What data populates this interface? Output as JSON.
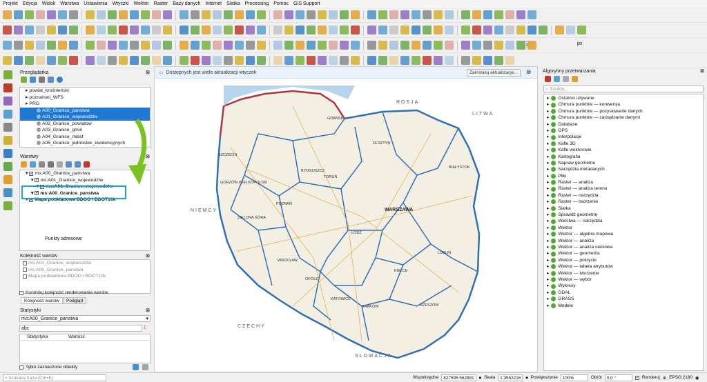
{
  "menu": [
    "Projekt",
    "Edycja",
    "Widok",
    "Warstwa",
    "Ustawienia",
    "Wtyczki",
    "Wektor",
    "Raster",
    "Bazy danych",
    "Internet",
    "Siatka",
    "Processing",
    "Pomoc",
    "GIS Support"
  ],
  "toolbar": {
    "size_value": "12",
    "size_unit": "px"
  },
  "browser": {
    "title": "Przeglądarka",
    "items": [
      {
        "label": "powiat_krośnieński",
        "indent": 1,
        "selected": false
      },
      {
        "label": "poznański_WFS",
        "indent": 1,
        "selected": false
      },
      {
        "label": "PRG",
        "indent": 1,
        "selected": false
      },
      {
        "label": "A00_Granice_panstwa",
        "indent": 3,
        "selected": true
      },
      {
        "label": "A01_Granice_wojewodztw",
        "indent": 3,
        "selected": true
      },
      {
        "label": "A02_Granice_powiatow",
        "indent": 3,
        "selected": false
      },
      {
        "label": "A03_Granice_gmin",
        "indent": 3,
        "selected": false
      },
      {
        "label": "A04_Granice_miast",
        "indent": 3,
        "selected": false
      },
      {
        "label": "A05_Granice_jednostek_ewidencyjnych",
        "indent": 3,
        "selected": false
      }
    ]
  },
  "layers": {
    "title": "Warstwy",
    "items": [
      {
        "label": "ms:A00_Granice_panstwa",
        "indent": 1,
        "bold": false
      },
      {
        "label": "ms:A01_Granice_wojewodztw",
        "indent": 2,
        "bold": false
      },
      {
        "label": "ms:A01_Granice_wojewodztw",
        "indent": 3,
        "bold": true
      },
      {
        "label": "ms:A00_Granice_panstwa",
        "indent": 2,
        "bold": true
      },
      {
        "label": "Mapa podkladowa BDOO i BDOT10k",
        "indent": 1,
        "bold": true
      }
    ],
    "extra": "Punkty adresowe"
  },
  "order": {
    "title": "Kolejność warstw",
    "items": [
      "ms:A01_Granice_wojewodztw",
      "ms:A00_Granice_panstwa",
      "Mapa podkładowa BDOO i BDOT10k"
    ],
    "control_label": "Kontroluj kolejność renderowania warstw",
    "tabs": [
      "Kolejność warstw",
      "Podgląd"
    ]
  },
  "stats": {
    "title": "Statystyki",
    "layer": "ms:A00_Granice_panstwa",
    "field": "abc",
    "col1": "Statystyka",
    "col2": "Wartość",
    "only_selected": "Tylko zaznaczone obiekty"
  },
  "message": {
    "text": "Dostępnych jest wiele aktualizacji wtyczek",
    "button": "Zainstaluj aktualizacje..."
  },
  "map": {
    "neighbors": [
      "ROSJA",
      "LITWA",
      "NIEMCY",
      "CZECHY",
      "SŁOWACJA"
    ],
    "cities": [
      "GDAŃSK",
      "OLSZTYN",
      "SZCZECIN",
      "BYDGOSZCZ",
      "TORUŃ",
      "BIAŁYSTOK",
      "GORZÓW WIELKOPOLSKI",
      "POZNAŃ",
      "WARSZAWA",
      "ZIELONA GÓRA",
      "ŁÓDŹ",
      "WROCŁAW",
      "LUBLIN",
      "OPOLE",
      "KIELCE",
      "KATOWICE",
      "KRAKÓW",
      "RZESZÓW"
    ]
  },
  "processing": {
    "title": "Algorytmy przetwarzania",
    "search": "Szukaj...",
    "items": [
      "Ostatnio używane",
      "Chmura punktów — konwersja",
      "Chmura punktów — pozyskiwanie danych",
      "Chmura punktów — zarządzanie danymi",
      "Database",
      "GPS",
      "Interpolacje",
      "Kafle 3D",
      "Kafle wektorowe",
      "Kartografia",
      "Napraw geometrie",
      "Narzędzia metadanych",
      "Pliki",
      "Raster — analiza",
      "Raster — analiza terenu",
      "Raster — narzędzia",
      "Raster — tworzenie",
      "Siatka",
      "Sprawdź geometrię",
      "Warstwa — narzędzia",
      "Wektor",
      "Wektor — algebra mapowa",
      "Wektor — analiza",
      "Wektor — analiza sieciowa",
      "Wektor — geometria",
      "Wektor — pokrycie",
      "Wektor — tabela atrybutów",
      "Wektor — tworzenie",
      "Wektor — wybór",
      "Wykresy",
      "GDAL",
      "GRASS",
      "Modele"
    ]
  },
  "status": {
    "search": "Szukana fraza (Ctrl+K)",
    "coord_label": "Współrzędne",
    "coord": "827595  562881",
    "scale_label": "Skala",
    "scale": "1:3552216",
    "zoom_label": "Powiększenie",
    "zoom": "100%",
    "rot_label": "Obrót",
    "rot": "0,0 °",
    "render": "Renderuj",
    "crs": "EPSG:2180"
  }
}
